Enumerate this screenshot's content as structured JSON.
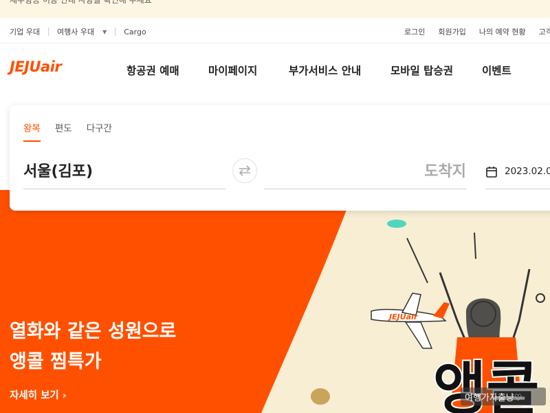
{
  "notice": {
    "text": "제주항공 이용 안내 사항을 확인해 주세요"
  },
  "util_bar": {
    "left": [
      "기업 우대",
      "여행사 우대",
      "Cargo"
    ],
    "right": [
      "로그인",
      "회원가입",
      "나의 예약 현황",
      "고객"
    ]
  },
  "brand": {
    "logo": "JEJUair",
    "accent": "#ff5000"
  },
  "nav": {
    "items": [
      "항공권 예매",
      "마이페이지",
      "부가서비스 안내",
      "모바일 탑승권",
      "이벤트"
    ]
  },
  "booking": {
    "tabs": [
      "왕복",
      "편도",
      "다구간"
    ],
    "active_tab": "왕복",
    "origin": "서울(김포)",
    "destination_placeholder": "도착지",
    "date": "2023.02.0"
  },
  "hero": {
    "title_line1": "열화와 같은 성원으로",
    "title_line2": "앵콜 찜특가",
    "more_label": "자세히 보기 ›",
    "plane_logo": "JEJUair",
    "big_text": "앵콜"
  },
  "watermark": {
    "text": "여행가자출냥♡"
  }
}
